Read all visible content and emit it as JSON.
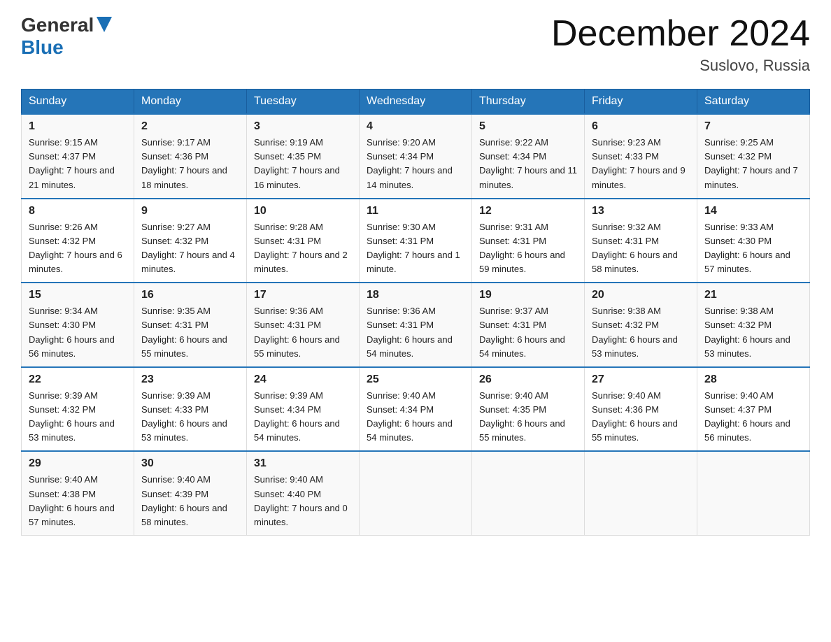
{
  "header": {
    "logo_line1": "General",
    "logo_line2": "Blue",
    "title": "December 2024",
    "subtitle": "Suslovo, Russia"
  },
  "days_of_week": [
    "Sunday",
    "Monday",
    "Tuesday",
    "Wednesday",
    "Thursday",
    "Friday",
    "Saturday"
  ],
  "weeks": [
    [
      {
        "num": "1",
        "sunrise": "9:15 AM",
        "sunset": "4:37 PM",
        "daylight": "7 hours and 21 minutes."
      },
      {
        "num": "2",
        "sunrise": "9:17 AM",
        "sunset": "4:36 PM",
        "daylight": "7 hours and 18 minutes."
      },
      {
        "num": "3",
        "sunrise": "9:19 AM",
        "sunset": "4:35 PM",
        "daylight": "7 hours and 16 minutes."
      },
      {
        "num": "4",
        "sunrise": "9:20 AM",
        "sunset": "4:34 PM",
        "daylight": "7 hours and 14 minutes."
      },
      {
        "num": "5",
        "sunrise": "9:22 AM",
        "sunset": "4:34 PM",
        "daylight": "7 hours and 11 minutes."
      },
      {
        "num": "6",
        "sunrise": "9:23 AM",
        "sunset": "4:33 PM",
        "daylight": "7 hours and 9 minutes."
      },
      {
        "num": "7",
        "sunrise": "9:25 AM",
        "sunset": "4:32 PM",
        "daylight": "7 hours and 7 minutes."
      }
    ],
    [
      {
        "num": "8",
        "sunrise": "9:26 AM",
        "sunset": "4:32 PM",
        "daylight": "7 hours and 6 minutes."
      },
      {
        "num": "9",
        "sunrise": "9:27 AM",
        "sunset": "4:32 PM",
        "daylight": "7 hours and 4 minutes."
      },
      {
        "num": "10",
        "sunrise": "9:28 AM",
        "sunset": "4:31 PM",
        "daylight": "7 hours and 2 minutes."
      },
      {
        "num": "11",
        "sunrise": "9:30 AM",
        "sunset": "4:31 PM",
        "daylight": "7 hours and 1 minute."
      },
      {
        "num": "12",
        "sunrise": "9:31 AM",
        "sunset": "4:31 PM",
        "daylight": "6 hours and 59 minutes."
      },
      {
        "num": "13",
        "sunrise": "9:32 AM",
        "sunset": "4:31 PM",
        "daylight": "6 hours and 58 minutes."
      },
      {
        "num": "14",
        "sunrise": "9:33 AM",
        "sunset": "4:30 PM",
        "daylight": "6 hours and 57 minutes."
      }
    ],
    [
      {
        "num": "15",
        "sunrise": "9:34 AM",
        "sunset": "4:30 PM",
        "daylight": "6 hours and 56 minutes."
      },
      {
        "num": "16",
        "sunrise": "9:35 AM",
        "sunset": "4:31 PM",
        "daylight": "6 hours and 55 minutes."
      },
      {
        "num": "17",
        "sunrise": "9:36 AM",
        "sunset": "4:31 PM",
        "daylight": "6 hours and 55 minutes."
      },
      {
        "num": "18",
        "sunrise": "9:36 AM",
        "sunset": "4:31 PM",
        "daylight": "6 hours and 54 minutes."
      },
      {
        "num": "19",
        "sunrise": "9:37 AM",
        "sunset": "4:31 PM",
        "daylight": "6 hours and 54 minutes."
      },
      {
        "num": "20",
        "sunrise": "9:38 AM",
        "sunset": "4:32 PM",
        "daylight": "6 hours and 53 minutes."
      },
      {
        "num": "21",
        "sunrise": "9:38 AM",
        "sunset": "4:32 PM",
        "daylight": "6 hours and 53 minutes."
      }
    ],
    [
      {
        "num": "22",
        "sunrise": "9:39 AM",
        "sunset": "4:32 PM",
        "daylight": "6 hours and 53 minutes."
      },
      {
        "num": "23",
        "sunrise": "9:39 AM",
        "sunset": "4:33 PM",
        "daylight": "6 hours and 53 minutes."
      },
      {
        "num": "24",
        "sunrise": "9:39 AM",
        "sunset": "4:34 PM",
        "daylight": "6 hours and 54 minutes."
      },
      {
        "num": "25",
        "sunrise": "9:40 AM",
        "sunset": "4:34 PM",
        "daylight": "6 hours and 54 minutes."
      },
      {
        "num": "26",
        "sunrise": "9:40 AM",
        "sunset": "4:35 PM",
        "daylight": "6 hours and 55 minutes."
      },
      {
        "num": "27",
        "sunrise": "9:40 AM",
        "sunset": "4:36 PM",
        "daylight": "6 hours and 55 minutes."
      },
      {
        "num": "28",
        "sunrise": "9:40 AM",
        "sunset": "4:37 PM",
        "daylight": "6 hours and 56 minutes."
      }
    ],
    [
      {
        "num": "29",
        "sunrise": "9:40 AM",
        "sunset": "4:38 PM",
        "daylight": "6 hours and 57 minutes."
      },
      {
        "num": "30",
        "sunrise": "9:40 AM",
        "sunset": "4:39 PM",
        "daylight": "6 hours and 58 minutes."
      },
      {
        "num": "31",
        "sunrise": "9:40 AM",
        "sunset": "4:40 PM",
        "daylight": "7 hours and 0 minutes."
      },
      null,
      null,
      null,
      null
    ]
  ]
}
